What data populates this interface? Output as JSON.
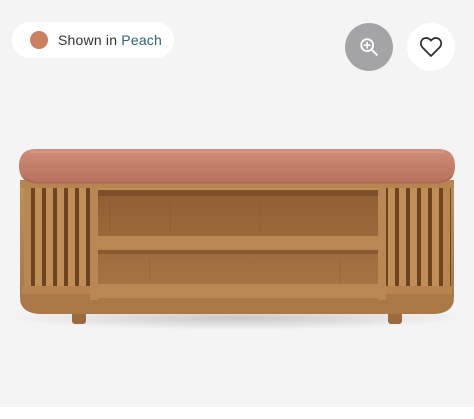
{
  "color_badge": {
    "prefix": "Shown in",
    "color_name": "Peach",
    "swatch_color": "#cd7f62",
    "accent_text_color": "#2e6273"
  },
  "actions": {
    "zoom_icon": "zoom-in-icon",
    "zoom_bg_color": "#a4a4a6",
    "favorite_icon": "heart-outline-icon"
  },
  "product": {
    "image_subject": "storage-bench",
    "cushion_color": "#c9806b",
    "wood_color": "#b98550"
  }
}
